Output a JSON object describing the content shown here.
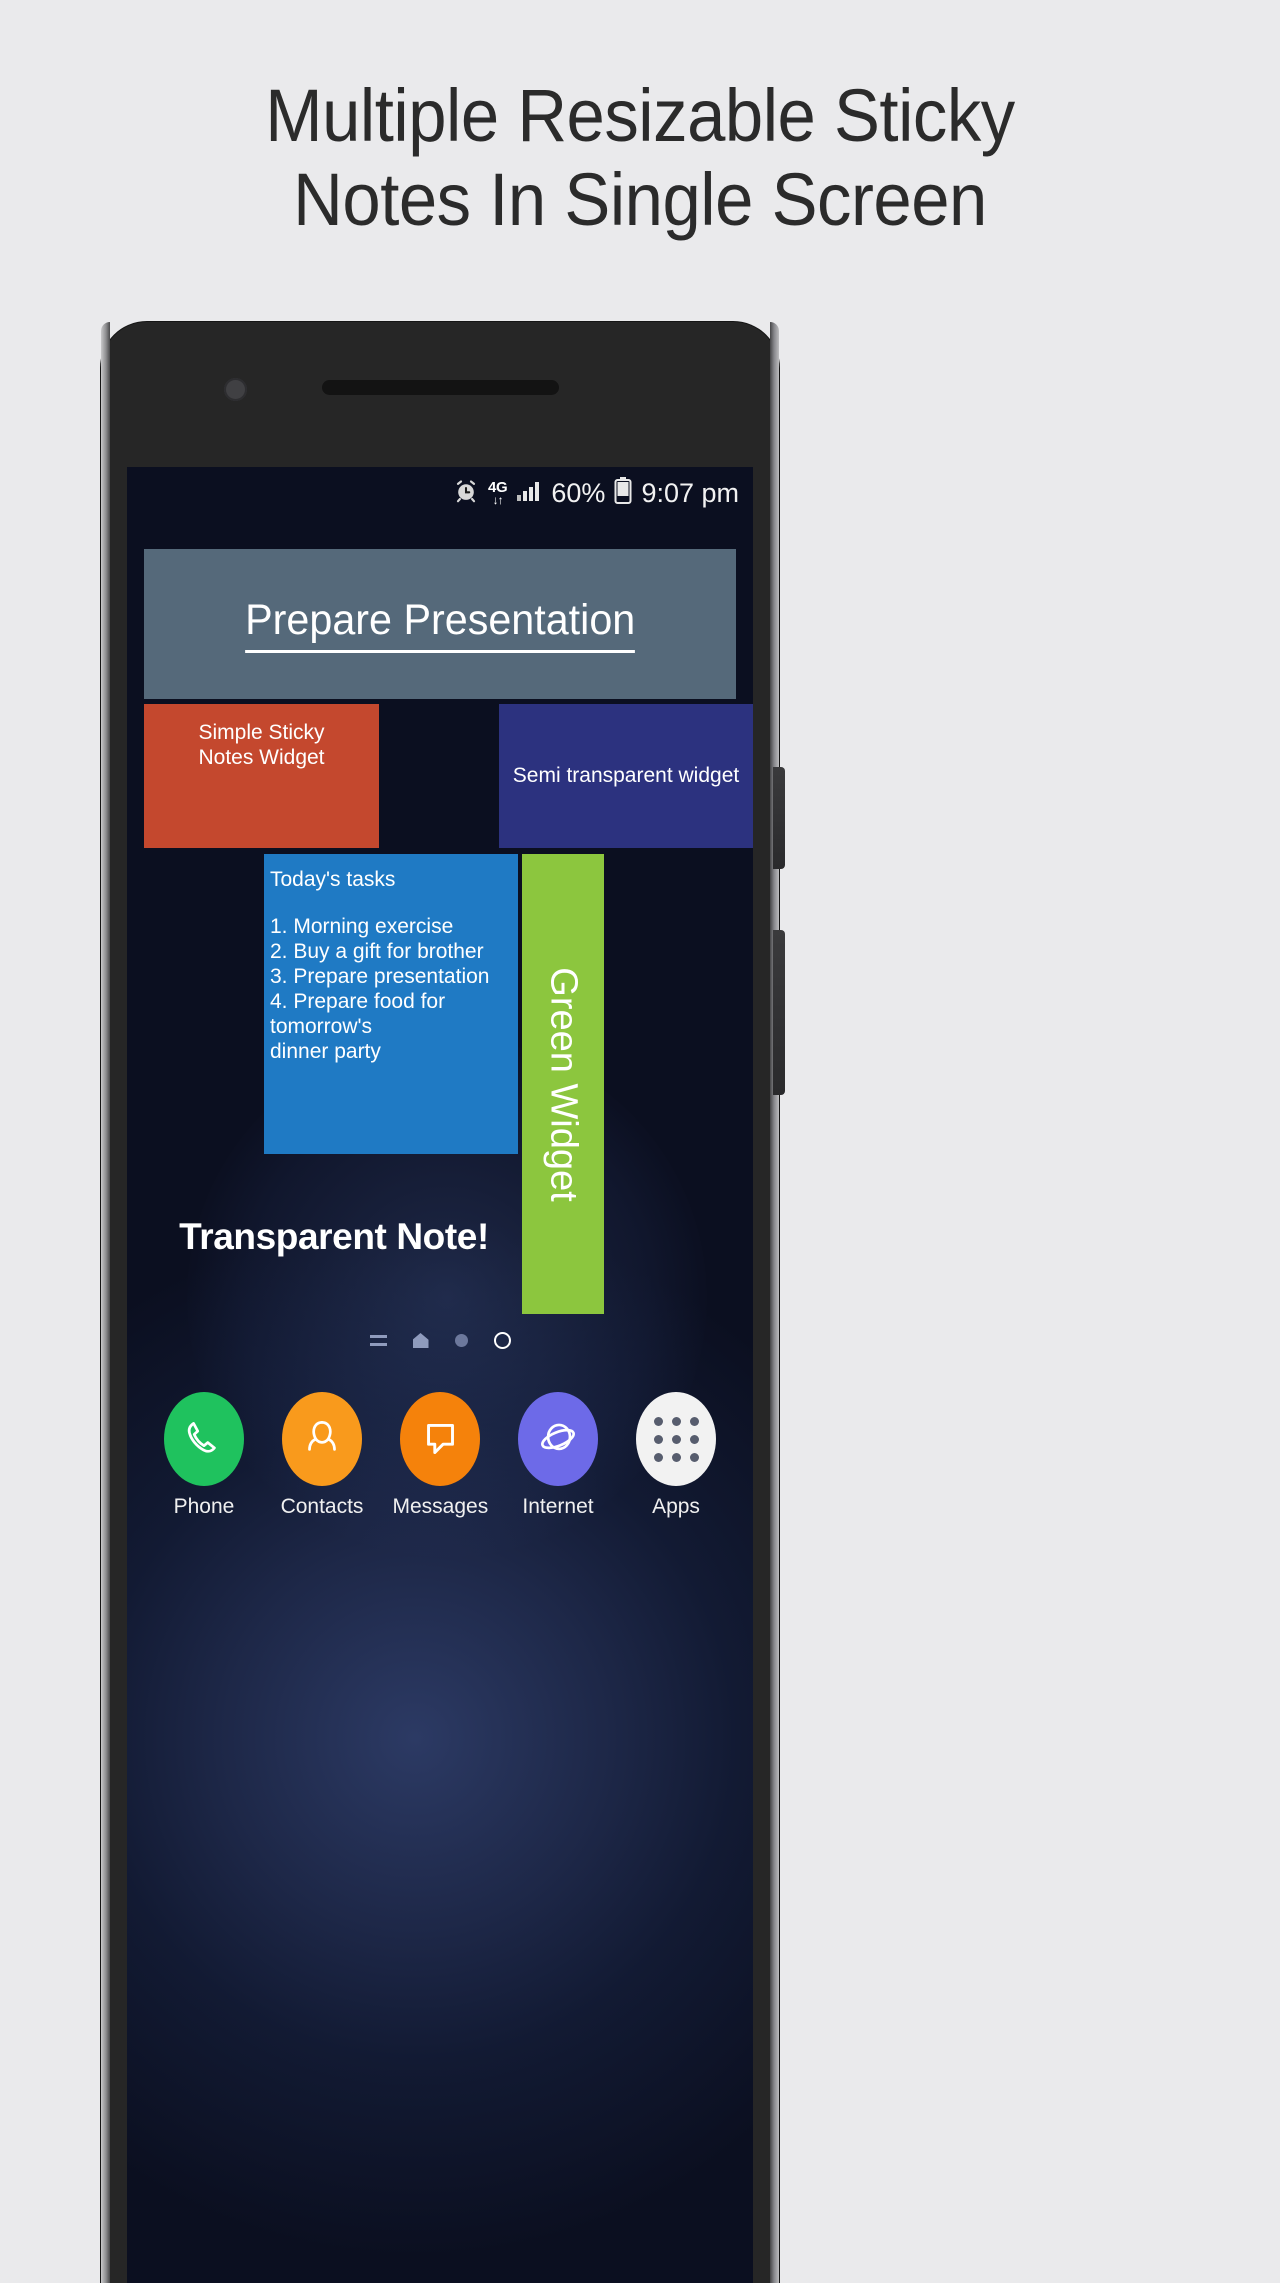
{
  "headline": {
    "line1": "Multiple Resizable Sticky",
    "line2": "Notes In Single Screen"
  },
  "colors": {
    "page_background": "#eaeaec",
    "headline_text": "#2b2b2b",
    "phone_body": "#262626",
    "widget_presentation": "#55697a",
    "widget_red": "#c4482e",
    "widget_semi_transparent": "#31388c",
    "widget_tasks": "#1f7ac4",
    "widget_green": "#8cc63e",
    "dock_phone": "#1fc25e",
    "dock_contacts": "#f99a1c",
    "dock_messages": "#f5820b",
    "dock_internet": "#6d6ae8",
    "dock_apps": "#f2f2f2"
  },
  "statusbar": {
    "alarm_icon": "alarm-clock-icon",
    "network_type": "4G",
    "data_arrows": "↓↑",
    "signal_icon": "signal-bars-icon",
    "battery_percent": "60%",
    "battery_icon": "battery-icon",
    "time": "9:07 pm"
  },
  "widgets": {
    "presentation": {
      "text": "Prepare Presentation"
    },
    "red_note": {
      "line1": "Simple Sticky",
      "line2": "Notes Widget"
    },
    "semi_transparent": {
      "text": "Semi transparent widget"
    },
    "tasks": {
      "title": "Today's tasks",
      "items": [
        "1. Morning exercise",
        "2. Buy a gift for brother",
        "3. Prepare presentation",
        "4. Prepare food for tomorrow's",
        "dinner party"
      ]
    },
    "green": {
      "text": "Green Widget"
    },
    "transparent_note": {
      "text": "Transparent Note!"
    }
  },
  "pager": {
    "indicators": [
      "menu-lines-icon",
      "home-icon",
      "page-dot",
      "page-current-ring"
    ]
  },
  "dock": {
    "items": [
      {
        "label": "Phone",
        "icon": "phone-handset-icon"
      },
      {
        "label": "Contacts",
        "icon": "contacts-person-icon"
      },
      {
        "label": "Messages",
        "icon": "message-bubble-icon"
      },
      {
        "label": "Internet",
        "icon": "internet-globe-icon"
      },
      {
        "label": "Apps",
        "icon": "apps-grid-icon"
      }
    ]
  }
}
